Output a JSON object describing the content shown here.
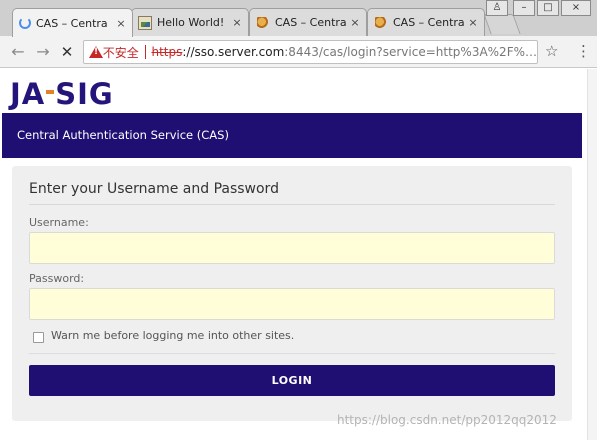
{
  "browser": {
    "tabs": [
      {
        "title": "CAS – Centra",
        "icon": "loading-spinner-icon",
        "close": "×",
        "active": true
      },
      {
        "title": "Hello World!",
        "icon": "image-favicon-icon",
        "close": "×",
        "active": false
      },
      {
        "title": "CAS – Centra",
        "icon": "cas-favicon-icon",
        "close": "×",
        "active": false
      },
      {
        "title": "CAS – Centra",
        "icon": "cas-favicon-icon",
        "close": "×",
        "active": false
      }
    ],
    "window_controls": {
      "user": "♙",
      "minimize": "–",
      "maximize": "□",
      "close": "×"
    },
    "nav": {
      "back": "←",
      "forward": "→",
      "reload": "✕"
    },
    "address": {
      "security_label": "不安全",
      "protocol": "https",
      "host": "://sso.server.com",
      "path": ":8443/cas/login?service=http%3A%2F%…"
    },
    "bookmark_icon": "☆",
    "menu_icon": "⋮"
  },
  "page": {
    "logo": {
      "left": "JA",
      "right": "SIG"
    },
    "header_title": "Central Authentication Service (CAS)",
    "form": {
      "title": "Enter your Username and Password",
      "username_label": "Username:",
      "username_value": "",
      "password_label": "Password:",
      "password_value": "",
      "warn_label": "Warn me before logging me into other sites.",
      "warn_checked": false,
      "submit_label": "LOGIN"
    },
    "watermark": "https://blog.csdn.net/pp2012qq2012"
  },
  "colors": {
    "brand_navy": "#200f73",
    "logo_accent": "#e0822a",
    "input_bg": "#fffed8",
    "insecure_red": "#c62828"
  }
}
